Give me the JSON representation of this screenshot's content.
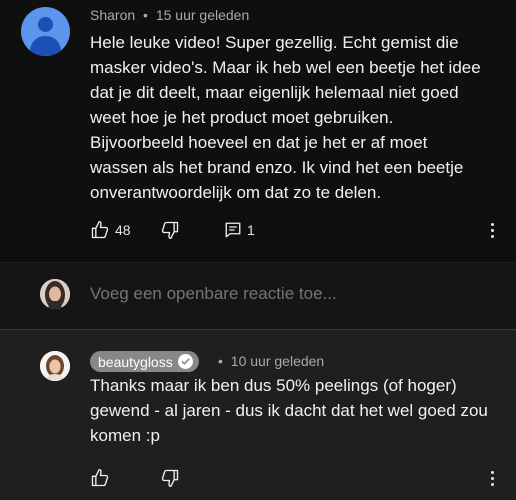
{
  "comment": {
    "author": "Sharon",
    "separator": "•",
    "time": "15 uur geleden",
    "text": "Hele leuke video! Super gezellig. Echt gemist die\nmasker video's. Maar ik heb wel een beetje het idee\ndat je dit deelt, maar eigenlijk helemaal niet goed\nweet hoe je het product moet gebruiken.\nBijvoorbeeld hoeveel en dat je het er af moet\nwassen als het brand enzo. Ik vind het een beetje\nonverantwoordelijk om dat zo te delen.",
    "like_count": "48",
    "reply_count": "1",
    "avatar_color": "#5d95ec"
  },
  "reply_box": {
    "placeholder": "Voeg een openbare reactie toe..."
  },
  "reply": {
    "author": "beautygloss",
    "separator": "•",
    "time": "10 uur geleden",
    "text": "Thanks maar ik ben dus 50% peelings (of hoger)\ngewend - al jaren - dus ik dacht dat het wel goed zou\nkomen :p",
    "author_chip_color": "#888888"
  },
  "icons": [
    "person-icon",
    "thumbs-up-icon",
    "thumbs-down-icon",
    "reply-comment-icon",
    "more-vert-icon",
    "verified-check-icon"
  ]
}
